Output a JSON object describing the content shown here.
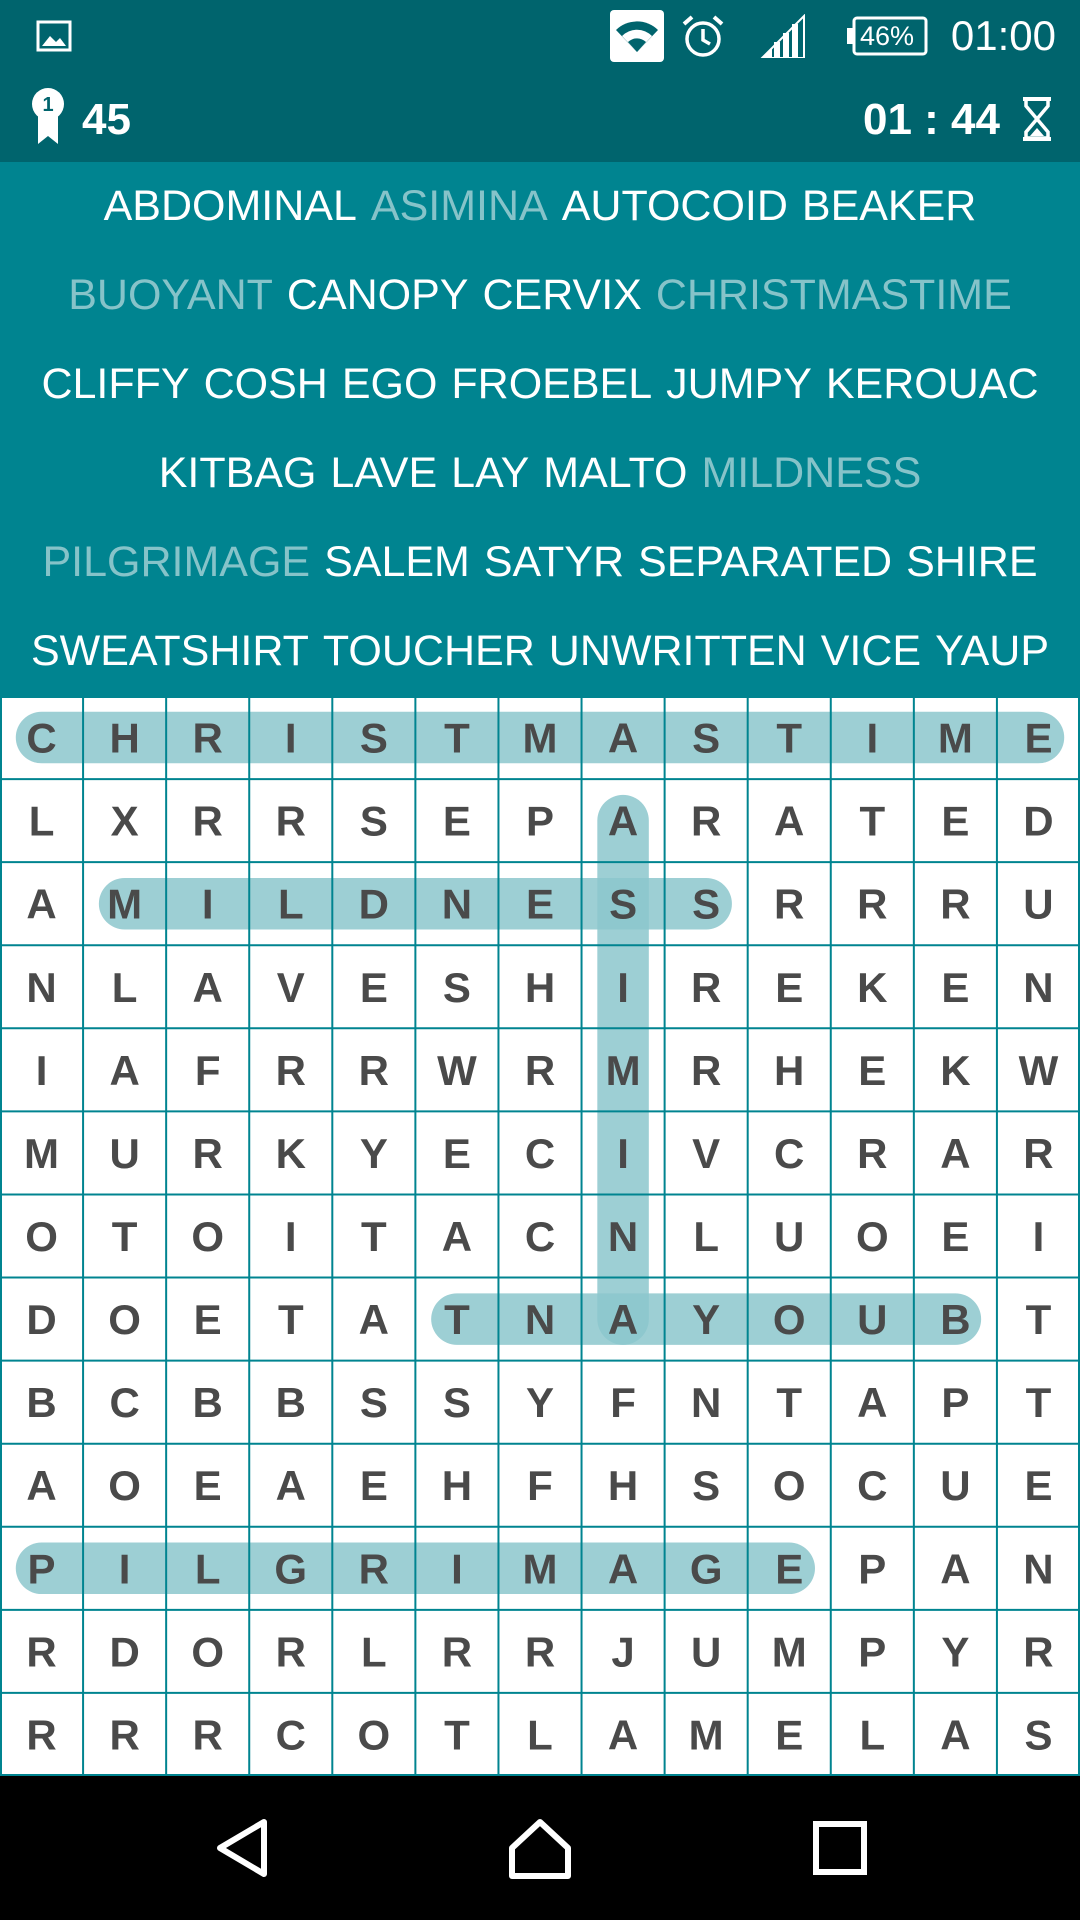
{
  "status_bar": {
    "battery_percent": "46%",
    "time": "01:00",
    "icons": [
      "gallery-icon",
      "wifi-icon",
      "alarm-icon",
      "signal-icon",
      "battery-icon"
    ]
  },
  "header": {
    "score": "45",
    "timer": "01 : 44",
    "icons": [
      "medal-icon",
      "hourglass-icon"
    ]
  },
  "word_list": [
    [
      {
        "text": "ABDOMINAL",
        "found": false
      },
      {
        "text": "ASIMINA",
        "found": true
      },
      {
        "text": "AUTOCOID",
        "found": false
      },
      {
        "text": "BEAKER",
        "found": false
      }
    ],
    [
      {
        "text": "BUOYANT",
        "found": true
      },
      {
        "text": "CANOPY",
        "found": false
      },
      {
        "text": "CERVIX",
        "found": false
      },
      {
        "text": "CHRISTMASTIME",
        "found": true
      }
    ],
    [
      {
        "text": "CLIFFY",
        "found": false
      },
      {
        "text": "COSH",
        "found": false
      },
      {
        "text": "EGO",
        "found": false
      },
      {
        "text": "FROEBEL",
        "found": false
      },
      {
        "text": "JUMPY",
        "found": false
      },
      {
        "text": "KEROUAC",
        "found": false
      }
    ],
    [
      {
        "text": "KITBAG",
        "found": false
      },
      {
        "text": "LAVE",
        "found": false
      },
      {
        "text": "LAY",
        "found": false
      },
      {
        "text": "MALTO",
        "found": false
      },
      {
        "text": "MILDNESS",
        "found": true
      }
    ],
    [
      {
        "text": "PILGRIMAGE",
        "found": true
      },
      {
        "text": "SALEM",
        "found": false
      },
      {
        "text": "SATYR",
        "found": false
      },
      {
        "text": "SEPARATED",
        "found": false
      },
      {
        "text": "SHIRE",
        "found": false
      }
    ],
    [
      {
        "text": "SWEATSHIRT",
        "found": false
      },
      {
        "text": "TOUCHER",
        "found": false
      },
      {
        "text": "UNWRITTEN",
        "found": false
      },
      {
        "text": "VICE",
        "found": false
      },
      {
        "text": "YAUP",
        "found": false
      }
    ]
  ],
  "grid": {
    "rows": [
      "CHRISTMASTIME",
      "LXRRSEPARATED",
      "AMILDNESSRRRU",
      "NLAVESHIREKEN",
      "IAFRRWRMRHEKW",
      "MURKYECIVCRAR",
      "OTOITACNLUOEI",
      "DOETATNAYOUBT",
      "BCBBSSYFNTAPT",
      "AOEAEHFHSOCUE",
      "PILGRIMAGEPAN",
      "RDORLRRJUMPYR",
      "RRRCOTLAMELAS"
    ],
    "found_highlights": [
      {
        "word": "CHRISTMASTIME",
        "start": [
          0,
          0
        ],
        "end": [
          0,
          12
        ]
      },
      {
        "word": "MILDNESS",
        "start": [
          2,
          1
        ],
        "end": [
          2,
          8
        ]
      },
      {
        "word": "ASIMINA",
        "start": [
          1,
          7
        ],
        "end": [
          7,
          7
        ]
      },
      {
        "word": "BUOYANT",
        "start": [
          7,
          11
        ],
        "end": [
          7,
          5
        ]
      },
      {
        "word": "PILGRIMAGE",
        "start": [
          10,
          0
        ],
        "end": [
          10,
          9
        ]
      }
    ]
  },
  "nav": {
    "icons": [
      "back-icon",
      "home-icon",
      "recents-icon"
    ]
  },
  "colors": {
    "header_bg": "#00646d",
    "word_panel_bg": "#008490",
    "word_active": "#ffffff",
    "word_found": "#86c3c9",
    "grid_line": "#008490",
    "grid_letter": "#4a4a4a",
    "highlight": "#8cc7cd"
  }
}
